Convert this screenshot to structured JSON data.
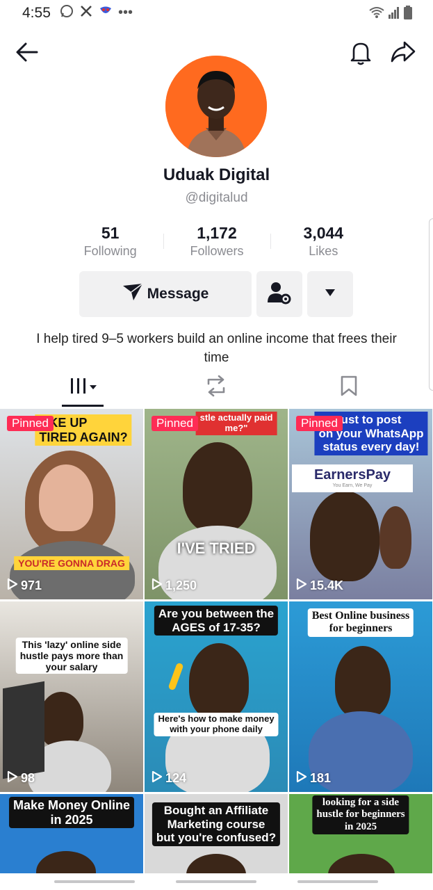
{
  "status_bar": {
    "time": "4:55"
  },
  "profile": {
    "name": "Uduak Digital",
    "handle": "@digitalud",
    "stats": [
      {
        "value": "51",
        "label": "Following"
      },
      {
        "value": "1,172",
        "label": "Followers"
      },
      {
        "value": "3,044",
        "label": "Likes"
      }
    ],
    "message_label": "Message",
    "bio": "I help tired 9–5 workers build an online income that frees their time"
  },
  "videos": [
    {
      "pinned": "Pinned",
      "caption": "OKE UP\nTIRED AGAIN?",
      "caption2": "YOU'RE GONNA DRAG",
      "views": "971"
    },
    {
      "pinned": "Pinned",
      "caption": "stle actually paid\nme?\"",
      "caption2": "I'VE TRIED",
      "views": "1,250"
    },
    {
      "pinned": "Pinned",
      "caption": "ust to post\non your WhatsApp\nstatus every day!",
      "caption2": "EarnersPay",
      "caption3": "You Earn, We Pay",
      "views": "15.4K"
    },
    {
      "caption": "This 'lazy' online side\nhustle pays more than\nyour salary",
      "views": "98"
    },
    {
      "caption": "Are you between the\nAGES of 17-35?",
      "caption2": "Here's how to make money\nwith your phone daily",
      "views": "124"
    },
    {
      "caption": "Best Online business\nfor beginners",
      "views": "181"
    },
    {
      "caption": "Make Money Online\nin 2025"
    },
    {
      "caption": "Bought an Affiliate\nMarketing course\nbut you're confused?"
    },
    {
      "caption": "looking for a side\nhustle for beginners\nin 2025"
    }
  ]
}
